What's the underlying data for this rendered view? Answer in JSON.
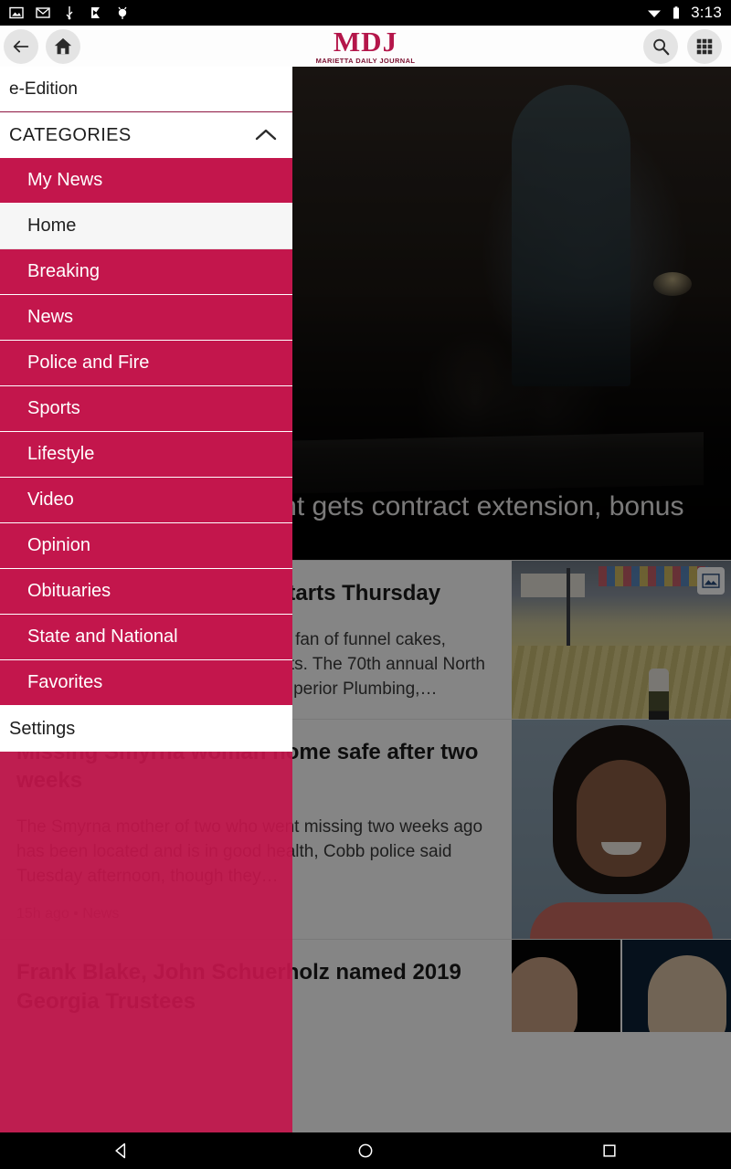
{
  "status_bar": {
    "time": "3:13",
    "left_icons": [
      "screenshot-icon",
      "gmail-icon",
      "usb-icon",
      "vlc-icon",
      "adb-icon"
    ],
    "right_icons": [
      "wifi-icon",
      "battery-icon"
    ]
  },
  "topbar": {
    "back_label": "Back",
    "home_label": "Home",
    "search_label": "Search",
    "grid_label": "Sections",
    "logo_main": "MDJ",
    "logo_sub": "MARIETTA DAILY JOURNAL"
  },
  "drawer": {
    "edition_label": "e-Edition",
    "categories_label": "CATEGORIES",
    "categories_expanded": true,
    "items": [
      {
        "label": "My News",
        "active": false
      },
      {
        "label": "Home",
        "active": true
      },
      {
        "label": "Breaking",
        "active": false
      },
      {
        "label": "News",
        "active": false
      },
      {
        "label": "Police and Fire",
        "active": false
      },
      {
        "label": "Sports",
        "active": false
      },
      {
        "label": "Lifestyle",
        "active": false
      },
      {
        "label": "Video",
        "active": false
      },
      {
        "label": "Opinion",
        "active": false
      },
      {
        "label": "Obituaries",
        "active": false
      },
      {
        "label": "State and National",
        "active": false
      },
      {
        "label": "Favorites",
        "active": false
      }
    ],
    "settings_label": "Settings",
    "accent_color": "#c3164c"
  },
  "feed": {
    "hero": {
      "headline": "Marietta superintendent gets contract extension, bonus"
    },
    "articles": [
      {
        "title": "North Georgia State Fair starts Thursday",
        "summary": "It's that time of the year – if you're a fan of funnel cakes, cannonballs, Ferris wheels and goats. The 70th annual North Georgia State Fair, presented by Superior Plumbing,…",
        "meta": ""
      },
      {
        "title": "Missing Smyrna woman home safe after two weeks",
        "summary": "The Smyrna mother of two who went missing two weeks ago has been located and is in good health, Cobb police said Tuesday afternoon, though they…",
        "meta": "15h ago • News"
      },
      {
        "title": "Frank Blake, John Schuerholz named 2019 Georgia Trustees",
        "summary": "",
        "meta": ""
      }
    ]
  },
  "navbar": {
    "back_label": "Back",
    "home_label": "Home",
    "recents_label": "Recents"
  }
}
